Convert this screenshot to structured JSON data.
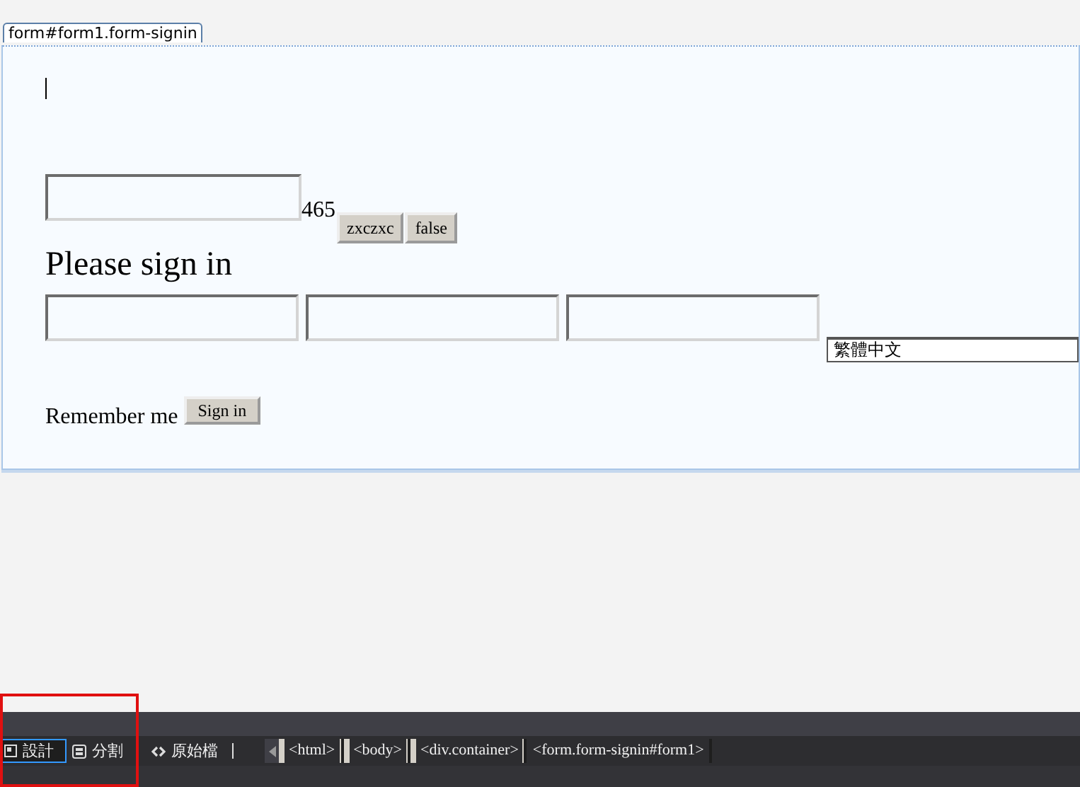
{
  "tag_label": "form#form1.form-signin",
  "form": {
    "caret": {
      "kind": "cursor"
    },
    "top_field": {
      "kind": "textbox"
    },
    "counter": "465",
    "buttons": [
      "zxczxc",
      "false"
    ],
    "heading": "Please sign in",
    "fields": [
      {
        "kind": "textbox"
      },
      {
        "kind": "textbox"
      },
      {
        "kind": "textbox"
      }
    ],
    "language_select": {
      "value": "繁體中文"
    },
    "remember_label": "Remember me",
    "submit": "Sign in"
  },
  "view_tabs": [
    {
      "label": "設計",
      "kind": "design",
      "selected": true
    },
    {
      "label": "分割",
      "kind": "split",
      "selected": false
    },
    {
      "label": "原始檔",
      "kind": "source",
      "selected": false
    }
  ],
  "breadcrumbs": [
    {
      "label": "<html>",
      "selected": false
    },
    {
      "label": "<body>",
      "selected": false
    },
    {
      "label": "<div.container>",
      "selected": false
    },
    {
      "label": "<form.form-signin#form1>",
      "selected": true
    }
  ],
  "highlight": {
    "kind": "frame",
    "color": "#e01010"
  }
}
